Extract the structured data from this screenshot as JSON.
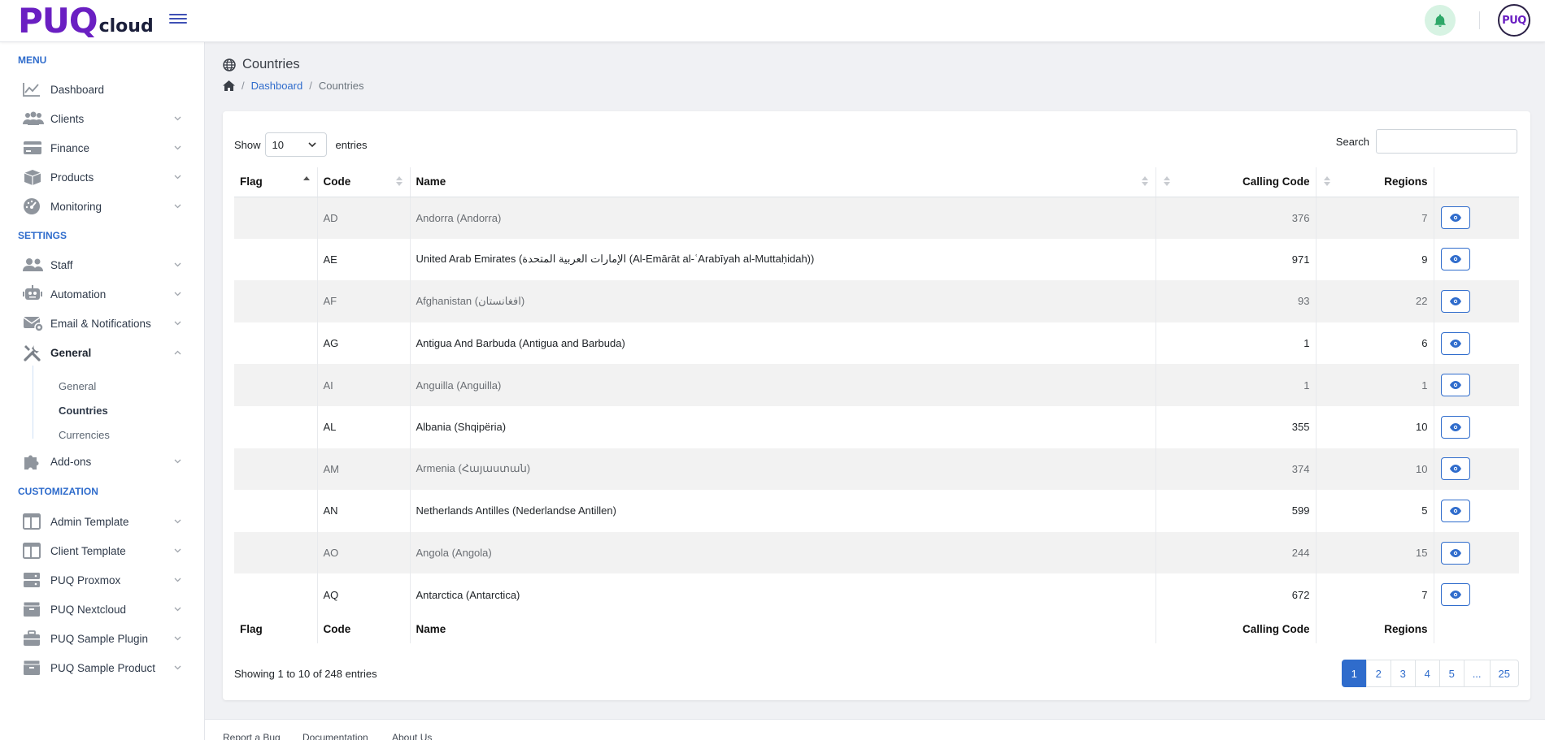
{
  "header": {
    "logo_main": "PUQ",
    "logo_sub": "cloud",
    "avatar_text": "PUQ"
  },
  "sidebar": {
    "sections": [
      "MENU",
      "SETTINGS",
      "CUSTOMIZATION"
    ],
    "menu": [
      {
        "label": "Dashboard",
        "icon": "chart-line-icon"
      },
      {
        "label": "Clients",
        "icon": "users-icon"
      },
      {
        "label": "Finance",
        "icon": "credit-card-icon"
      },
      {
        "label": "Products",
        "icon": "box-icon"
      },
      {
        "label": "Monitoring",
        "icon": "gauge-icon"
      }
    ],
    "settings": [
      {
        "label": "Staff",
        "icon": "user-group-icon"
      },
      {
        "label": "Automation",
        "icon": "robot-icon"
      },
      {
        "label": "Email & Notifications",
        "icon": "mail-gear-icon"
      },
      {
        "label": "General",
        "icon": "tools-icon"
      }
    ],
    "general_sub": [
      "General",
      "Countries",
      "Currencies"
    ],
    "addons": {
      "label": "Add-ons",
      "icon": "puzzle-icon"
    },
    "customization": [
      {
        "label": "Admin Template",
        "icon": "layout-icon"
      },
      {
        "label": "Client Template",
        "icon": "layout-icon"
      },
      {
        "label": "PUQ Proxmox",
        "icon": "server-icon"
      },
      {
        "label": "PUQ Nextcloud",
        "icon": "box-icon"
      },
      {
        "label": "PUQ Sample Plugin",
        "icon": "briefcase-icon"
      },
      {
        "label": "PUQ Sample Product",
        "icon": "box-icon"
      }
    ]
  },
  "page": {
    "title": "Countries",
    "breadcrumb": [
      "Dashboard",
      "Countries"
    ]
  },
  "table": {
    "show_label": "Show",
    "entries_label": "entries",
    "page_size": "10",
    "search_label": "Search",
    "search_value": "",
    "columns": [
      "Flag",
      "Code",
      "Name",
      "Calling Code",
      "Regions"
    ],
    "rows": [
      {
        "code": "AD",
        "name": "Andorra (Andorra)",
        "calling": "376",
        "regions": "7"
      },
      {
        "code": "AE",
        "name": "United Arab Emirates (الإمارات العربية المتحدة (Al-Emārāt al-ʿArabīyah al-Muttaḥidah))",
        "calling": "971",
        "regions": "9"
      },
      {
        "code": "AF",
        "name": "Afghanistan (افغانستان)",
        "calling": "93",
        "regions": "22"
      },
      {
        "code": "AG",
        "name": "Antigua And Barbuda (Antigua and Barbuda)",
        "calling": "1",
        "regions": "6"
      },
      {
        "code": "AI",
        "name": "Anguilla (Anguilla)",
        "calling": "1",
        "regions": "1"
      },
      {
        "code": "AL",
        "name": "Albania (Shqipëria)",
        "calling": "355",
        "regions": "10"
      },
      {
        "code": "AM",
        "name": "Armenia (Հայաստան)",
        "calling": "374",
        "regions": "10"
      },
      {
        "code": "AN",
        "name": "Netherlands Antilles (Nederlandse Antillen)",
        "calling": "599",
        "regions": "5"
      },
      {
        "code": "AO",
        "name": "Angola (Angola)",
        "calling": "244",
        "regions": "15"
      },
      {
        "code": "AQ",
        "name": "Antarctica (Antarctica)",
        "calling": "672",
        "regions": "7"
      }
    ],
    "info": "Showing 1 to 10 of 248 entries",
    "pages": [
      "1",
      "2",
      "3",
      "4",
      "5",
      "...",
      "25"
    ],
    "current_page": "1"
  },
  "footer": {
    "links": [
      "Report a Bug",
      "Documentation",
      "About Us"
    ]
  },
  "colors": {
    "brand": "#6a1fc2",
    "accent": "#2f6ccc",
    "bell_bg": "#d7f3e3",
    "bell": "#2ea869"
  }
}
